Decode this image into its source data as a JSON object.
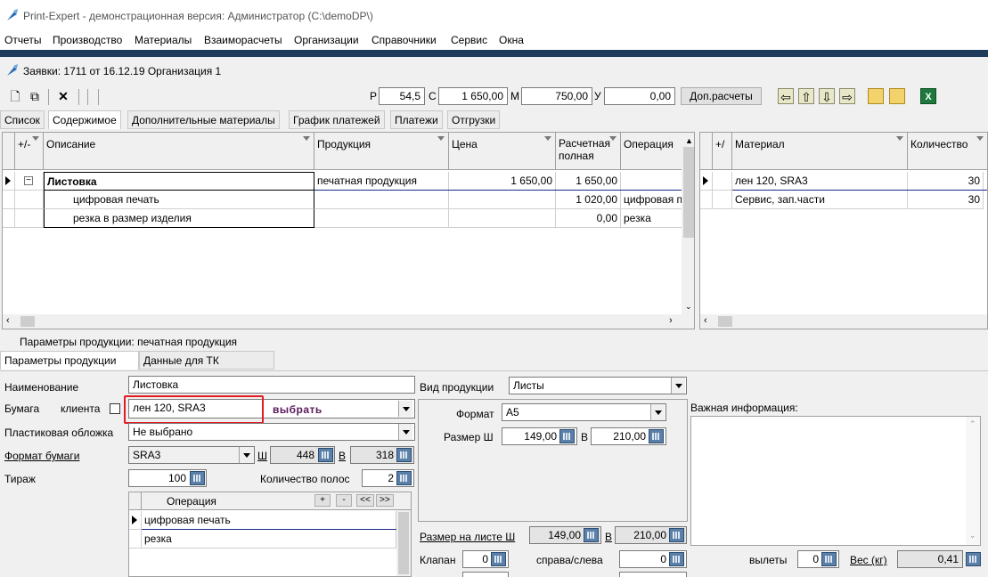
{
  "window": {
    "title": "Print-Expert - демонстрационная версия: Администратор (C:\\demoDP\\)"
  },
  "menu": [
    "Отчеты",
    "Производство",
    "Материалы",
    "Взаиморасчеты",
    "Организации",
    "Справочники",
    "Сервис",
    "Окна"
  ],
  "doc": {
    "title": "Заявки: 1711 от 16.12.19  Организация 1"
  },
  "toolbar": {
    "r_label": "Р",
    "r_value": "54,5",
    "c_label": "С",
    "c_value": "1 650,00",
    "m_label": "М",
    "m_value": "750,00",
    "u_label": "У",
    "u_value": "0,00",
    "extra_button": "Доп.расчеты"
  },
  "tabs": [
    "Список",
    "Содержимое",
    "Дополнительные материалы",
    "График платежей",
    "Платежи",
    "Отгрузки"
  ],
  "active_tab": "Содержимое",
  "grid": {
    "headers": {
      "pm": "+/-",
      "desc": "Описание",
      "product": "Продукция",
      "price": "Цена",
      "calc1": "Расчетная",
      "calc2": "полная",
      "op": "Операция"
    },
    "rows": [
      {
        "desc": "Листовка",
        "product": "печатная продукция",
        "price": "1 650,00",
        "calc": "1 650,00",
        "op": ""
      },
      {
        "desc": "цифровая печать",
        "product": "",
        "price": "",
        "calc": "1 020,00",
        "op": "цифровая п"
      },
      {
        "desc": "резка в размер изделия",
        "product": "",
        "price": "",
        "calc": "0,00",
        "op": "резка"
      }
    ]
  },
  "materials": {
    "headers": {
      "pm": "+/",
      "material": "Материал",
      "qty": "Количество"
    },
    "rows": [
      {
        "material": "лен 120, SRA3",
        "qty": "30"
      },
      {
        "material": "Сервис, зап.части",
        "qty": "30"
      }
    ]
  },
  "params": {
    "title": "Параметры продукции: печатная продукция",
    "tabs": [
      "Параметры продукции",
      "Данные для ТК"
    ],
    "name_label": "Наименование",
    "name_value": "Листовка",
    "paper_label": "Бумага",
    "client_label": "клиента",
    "paper_value": "лен 120, SRA3",
    "choose_label": "выбрать",
    "cover_label": "Пластиковая обложка",
    "cover_value": "Не выбрано",
    "format_label": "Формат бумаги",
    "format_value": "SRA3",
    "w_label": "Ш",
    "w_value": "448",
    "h_label": "В",
    "h_value": "318",
    "run_label": "Тираж",
    "run_value": "100",
    "strips_label": "Количество полос",
    "strips_value": "2",
    "ops_header": "Операция",
    "ops_plus": "+",
    "ops_minus": "-",
    "ops_prev": "<<",
    "ops_next": ">>",
    "ops": [
      "цифровая печать",
      "резка"
    ],
    "kind_label": "Вид продукции",
    "kind_value": "Листы",
    "fmt_label": "Формат",
    "fmt_value": "А5",
    "size_label": "Размер Ш",
    "size_w": "149,00",
    "size_b_label": "В",
    "size_h": "210,00",
    "sheet_label": "Размер на листе Ш",
    "sheet_w": "149,00",
    "sheet_b_label": "В",
    "sheet_h": "210,00",
    "flap_label": "Клапан",
    "flap_value": "0",
    "rl_label": "справа/слева",
    "rl_value": "0",
    "bleed_label": "вылеты",
    "bleed_value": "0",
    "weight_label": "Вес (кг)",
    "weight_value": "0,41",
    "info_label": "Важная информация:"
  },
  "colors": {
    "accent_highlight": "#e31b23",
    "bluebar": "#1f3b5c"
  }
}
